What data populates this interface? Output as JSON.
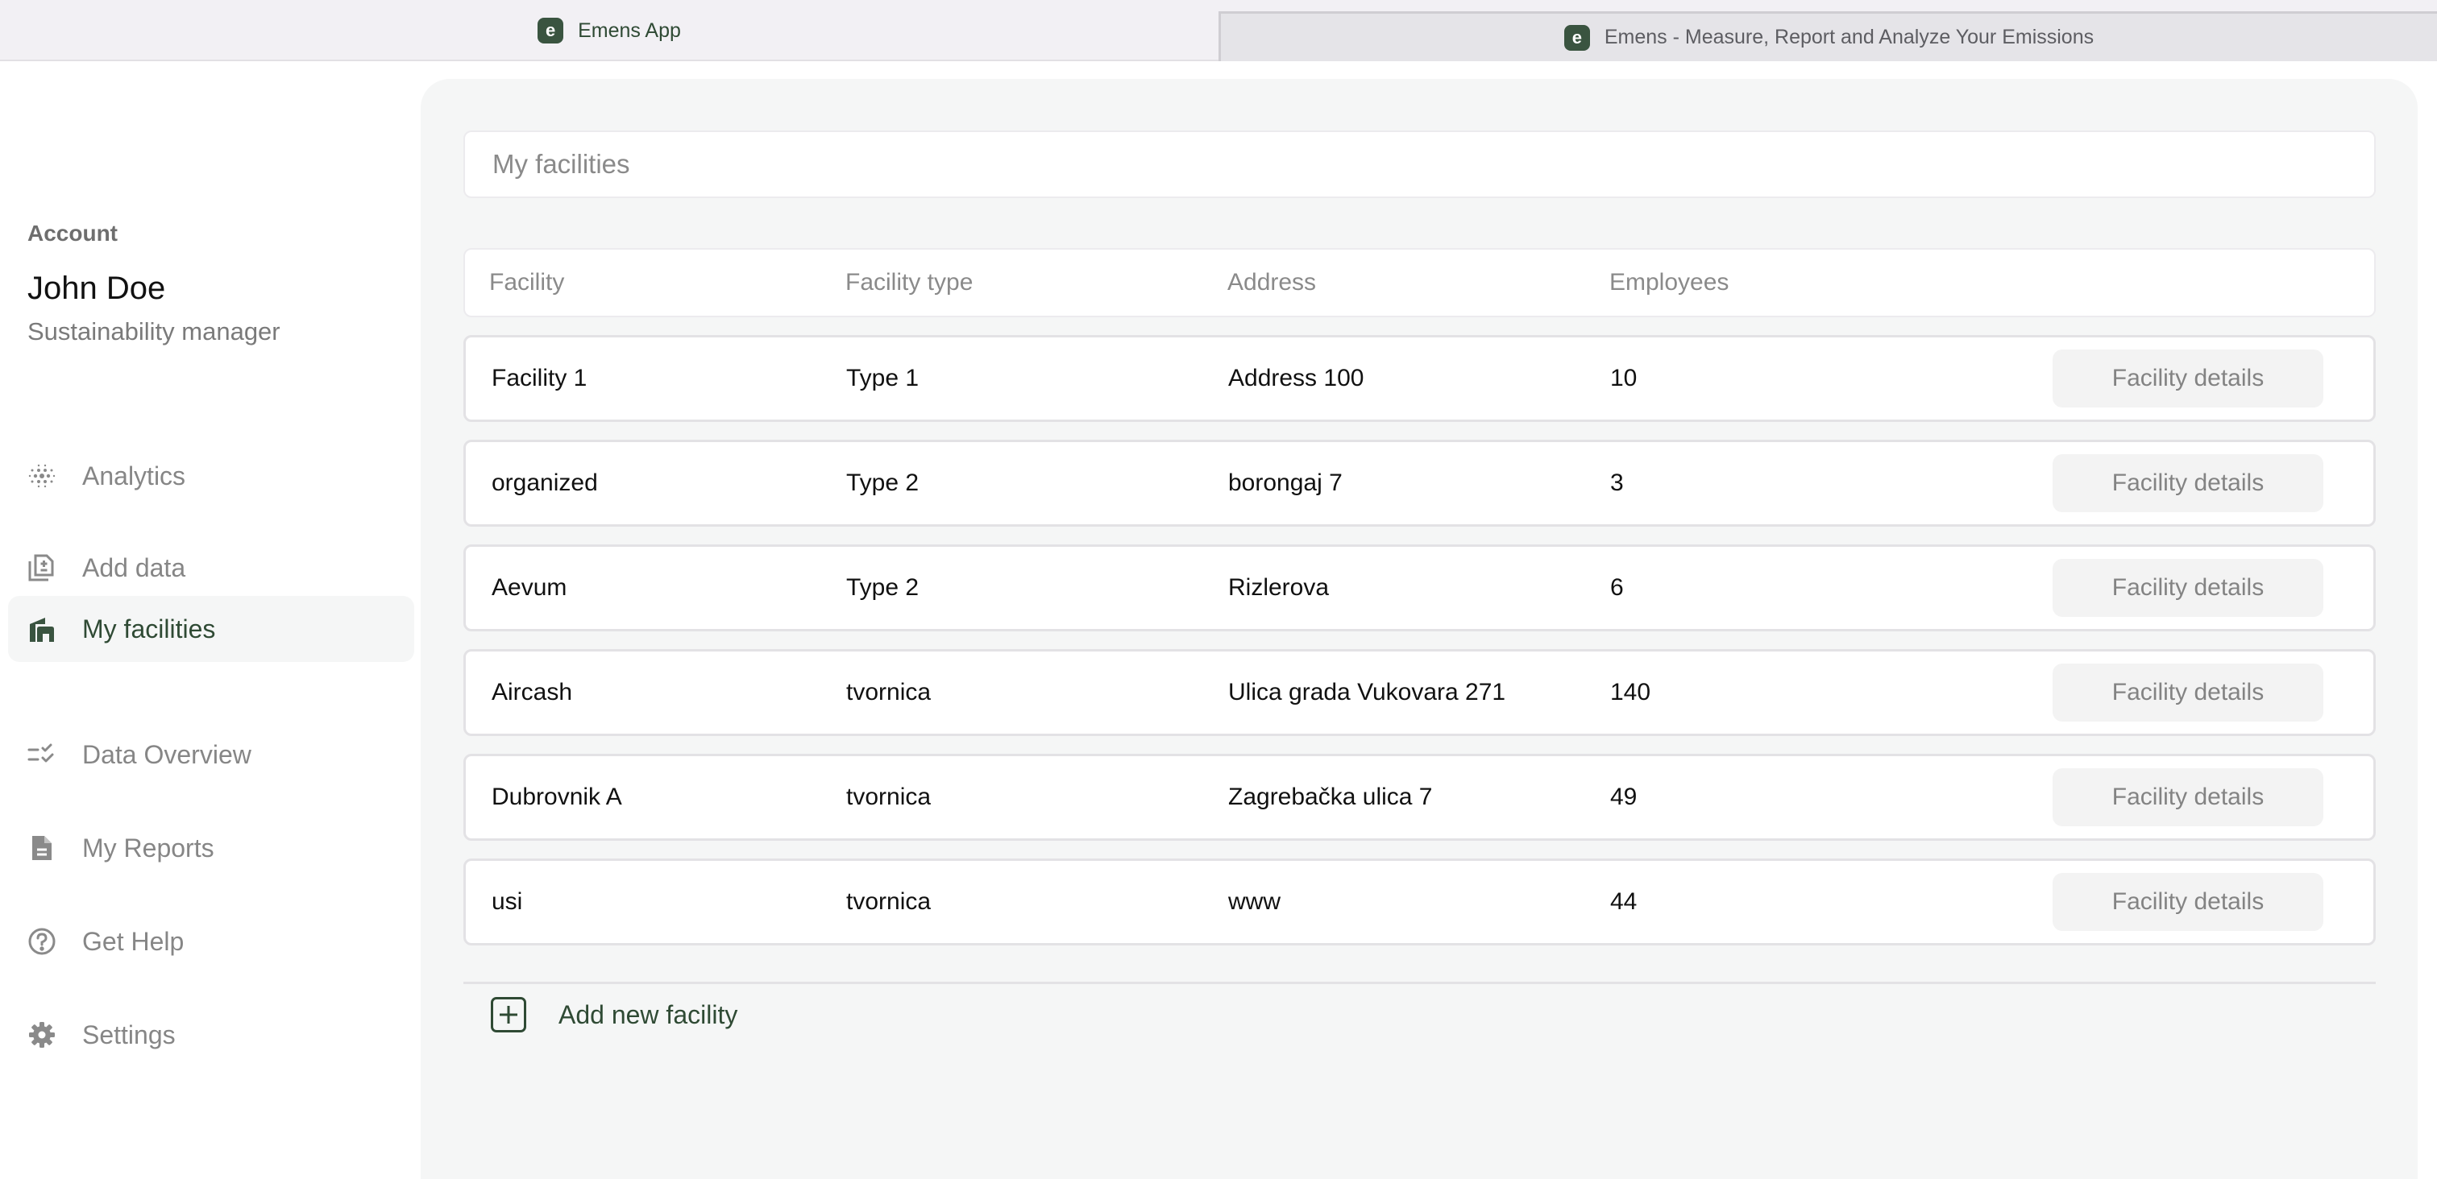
{
  "browser": {
    "tabs": [
      {
        "label": "Emens App",
        "active": true,
        "icon": "emens-logo-icon"
      },
      {
        "label": "Emens - Measure, Report and Analyze Your Emissions",
        "active": false,
        "icon": "emens-logo-icon"
      }
    ],
    "logo_glyph": "e"
  },
  "sidebar": {
    "account_label": "Account",
    "user_name": "John Doe",
    "user_role": "Sustainability manager",
    "items": [
      {
        "label": "Analytics",
        "icon": "analytics-dots-icon",
        "active": false
      },
      {
        "label": "Add data",
        "icon": "add-document-icon",
        "active": false
      },
      {
        "label": "My facilities",
        "icon": "facility-building-icon",
        "active": true
      },
      {
        "label": "Data Overview",
        "icon": "checklist-icon",
        "active": false
      },
      {
        "label": "My Reports",
        "icon": "report-file-icon",
        "active": false
      },
      {
        "label": "Get Help",
        "icon": "help-circle-icon",
        "active": false
      },
      {
        "label": "Settings",
        "icon": "gear-icon",
        "active": false
      }
    ]
  },
  "main": {
    "title": "My facilities",
    "columns": [
      "Facility",
      "Facility type",
      "Address",
      "Employees"
    ],
    "rows": [
      {
        "facility": "Facility 1",
        "type": "Type 1",
        "address": "Address 100",
        "employees": "10",
        "action": "Facility details"
      },
      {
        "facility": "organized",
        "type": "Type 2",
        "address": "borongaj 7",
        "employees": "3",
        "action": "Facility details"
      },
      {
        "facility": "Aevum",
        "type": "Type 2",
        "address": "Rizlerova",
        "employees": "6",
        "action": "Facility details"
      },
      {
        "facility": "Aircash",
        "type": "tvornica",
        "address": "Ulica grada Vukovara 271",
        "employees": "140",
        "action": "Facility details"
      },
      {
        "facility": "Dubrovnik A",
        "type": "tvornica",
        "address": "Zagrebačka ulica 7",
        "employees": "49",
        "action": "Facility details"
      },
      {
        "facility": "usi",
        "type": "tvornica",
        "address": "www",
        "employees": "44",
        "action": "Facility details"
      }
    ],
    "add_label": "Add new facility"
  },
  "colors": {
    "brand": "#2f4a34",
    "muted_text": "#868686",
    "panel_bg": "#f5f6f6",
    "button_bg": "#f3f3f3"
  }
}
